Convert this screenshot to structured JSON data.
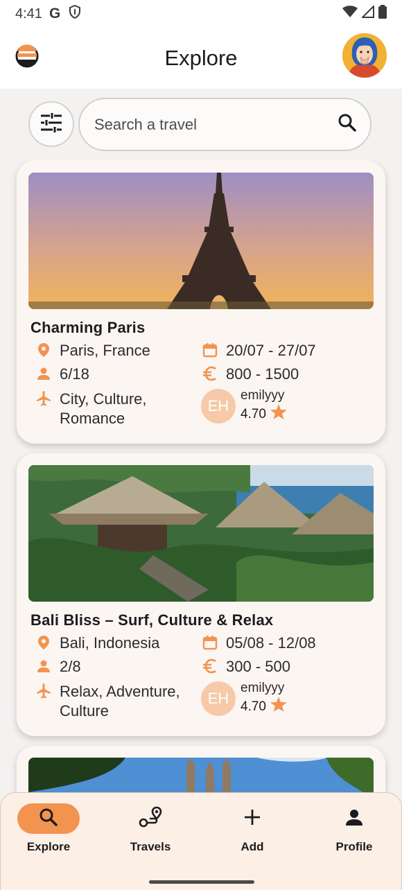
{
  "status_bar": {
    "time": "4:41",
    "google_letter": "G"
  },
  "app_bar": {
    "title": "Explore"
  },
  "search": {
    "placeholder": "Search a travel"
  },
  "colors": {
    "accent": "#f2934f",
    "card_bg": "#fcf6f3",
    "avatar_bg": "#f6c9a8",
    "nav_bg": "#fcefe6"
  },
  "travels": [
    {
      "name": "Charming Paris",
      "location": "Paris, France",
      "dates": "20/07 - 27/07",
      "people": "6/18",
      "price": "800 - 1500",
      "tags_line1": "City, Culture,",
      "tags_line2": "Romance",
      "host_initials": "EH",
      "host_username": "emilyyy",
      "host_rating": "4.70"
    },
    {
      "name": "Bali Bliss – Surf, Culture & Relax",
      "location": "Bali, Indonesia",
      "dates": "05/08 - 12/08",
      "people": "2/8",
      "price": "300 - 500",
      "tags_line1": "Relax, Adventure,",
      "tags_line2": "Culture",
      "host_initials": "EH",
      "host_username": "emilyyy",
      "host_rating": "4.70"
    }
  ],
  "nav": [
    {
      "label": "Explore",
      "icon": "search-icon",
      "active": true
    },
    {
      "label": "Travels",
      "icon": "route-icon",
      "active": false
    },
    {
      "label": "Add",
      "icon": "plus-icon",
      "active": false
    },
    {
      "label": "Profile",
      "icon": "person-icon",
      "active": false
    }
  ]
}
